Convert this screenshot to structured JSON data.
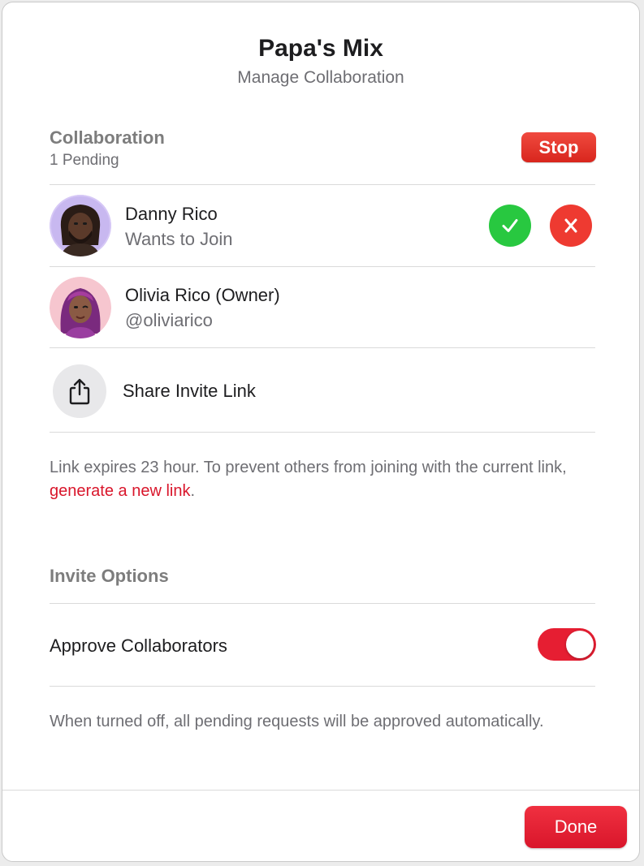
{
  "header": {
    "title": "Papa's Mix",
    "subtitle": "Manage Collaboration"
  },
  "collaboration": {
    "section_title": "Collaboration",
    "pending": "1 Pending",
    "stop_label": "Stop"
  },
  "people": [
    {
      "name": "Danny Rico",
      "status": "Wants to Join"
    },
    {
      "name": "Olivia Rico (Owner)",
      "status": "@oliviarico"
    }
  ],
  "share": {
    "label": "Share Invite Link",
    "icon": "share-icon"
  },
  "link_info": {
    "text": "Link expires 23 hour. To prevent others from joining with the current link, ",
    "link_text": "generate a new link",
    "suffix": "."
  },
  "invite_options": {
    "section_title": "Invite Options",
    "toggle_label": "Approve Collaborators",
    "toggle_on": true,
    "footnote": "When turned off, all pending requests will be approved automatically."
  },
  "footer": {
    "done_label": "Done"
  },
  "colors": {
    "accent": "#d9162b",
    "accept": "#28c840",
    "decline": "#ee3a31"
  }
}
